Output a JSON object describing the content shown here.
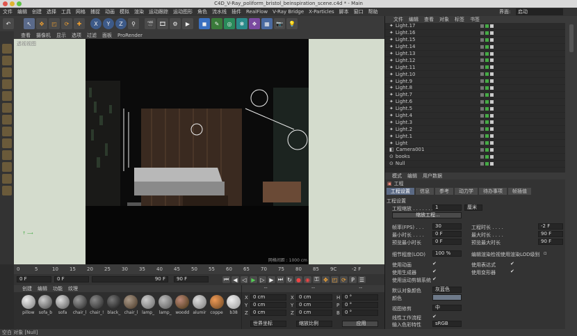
{
  "window": {
    "title": "C4D_V-Ray_poliform_bristol_beinspiration_scene.c4d * - Main"
  },
  "menu": [
    "文件",
    "编辑",
    "创建",
    "选择",
    "工具",
    "网格",
    "捕捉",
    "动画",
    "模拟",
    "渲染",
    "运动跟踪",
    "运动图形",
    "角色",
    "流水线",
    "插件",
    "RealFlow",
    "V-Ray Bridge",
    "X-Particles",
    "脚本",
    "窗口",
    "帮助"
  ],
  "layout": {
    "label": "界面:",
    "value": "启动"
  },
  "viewport": {
    "menu": [
      "查看",
      "摄像机",
      "显示",
      "选项",
      "过滤",
      "面板",
      "ProRender"
    ],
    "label": "透视视图",
    "grid_text": "网格间距 : 1000 cm"
  },
  "timeline": {
    "ticks": [
      "0",
      "5",
      "10",
      "15",
      "20",
      "25",
      "30",
      "35",
      "40",
      "45",
      "50",
      "55",
      "60",
      "65",
      "70",
      "75",
      "80",
      "85",
      "9C"
    ],
    "end_frame": "-2 F"
  },
  "playbar": {
    "start": "0 F",
    "current": "0 F",
    "end_a": "90 F",
    "end_b": "90 F"
  },
  "materials": {
    "menu": [
      "创建",
      "编辑",
      "功能",
      "纹理"
    ],
    "items": [
      "pillow",
      "sofa_b",
      "sofa",
      "chair_l",
      "chair_!",
      "black_",
      "chair_l",
      "lamp_",
      "lamp_",
      "woodd",
      "alumir",
      "coppe",
      "b38"
    ]
  },
  "coords": {
    "header": [
      "--",
      "--",
      "--"
    ],
    "rows": [
      {
        "axis": "X",
        "v1": "0 cm",
        "axis2": "X",
        "v2": "0 cm",
        "axis3": "H",
        "v3": "0 °"
      },
      {
        "axis": "Y",
        "v1": "0 cm",
        "axis2": "Y",
        "v2": "0 cm",
        "axis3": "P",
        "v3": "0 °"
      },
      {
        "axis": "Z",
        "v1": "0 cm",
        "axis2": "Z",
        "v2": "0 cm",
        "axis3": "B",
        "v3": "0 °"
      }
    ],
    "world": "世界坐标",
    "scale": "缩放比例",
    "apply": "应用"
  },
  "objects": {
    "tabs": [
      "文件",
      "编辑",
      "查看",
      "对象",
      "标签",
      "书签"
    ],
    "items": [
      "Light.17",
      "Light.16",
      "Light.15",
      "Light.14",
      "Light.13",
      "Light.12",
      "Light.11",
      "Light.10",
      "Light.9",
      "Light.8",
      "Light.7",
      "Light.6",
      "Light.5",
      "Light.4",
      "Light.3",
      "Light.2",
      "Light.1",
      "Light",
      "Camera001",
      "books",
      "Null"
    ]
  },
  "attributes": {
    "menu": [
      "模式",
      "编辑",
      "用户数据"
    ],
    "title": "工程",
    "tabs": [
      "工程设置",
      "信息",
      "参考",
      "动力学",
      "待办事项",
      "帧插值"
    ],
    "section": "工程设置",
    "scale_label": "工程缩放 . . . . . . .",
    "scale_value": "1",
    "scale_unit": "厘米",
    "scale_button": "缩放工程...",
    "left": [
      {
        "label": "帧率(FPS) . . .",
        "value": "30"
      },
      {
        "label": "最小时长 . . . .",
        "value": "0 F"
      },
      {
        "label": "预览最小时长",
        "value": "0 F"
      }
    ],
    "right": [
      {
        "label": "工程时长 . . . .",
        "value": "-2 F"
      },
      {
        "label": "最大时长 . . . .",
        "value": "90 F"
      },
      {
        "label": "预览最大时长",
        "value": "90 F"
      }
    ],
    "lod_label": "细节程度(LOD)",
    "lod_value": "100 %",
    "lod_check": "编辑渲染检视使用渲染LOD级别",
    "checks_left": [
      "使用动画",
      "使用生成器",
      "使用运动剪辑系统"
    ],
    "checks_right": [
      "使用表达式",
      "使用变形器"
    ],
    "default_color_label": "默认对象颜色",
    "default_color_value": "灰蓝色",
    "color_label": "颜色",
    "view_clip_label": "视图修剪",
    "view_clip_value": "中",
    "linear_label": "线性工作流程",
    "input_color_label": "输入色彩特性",
    "input_color_value": "sRGB"
  },
  "status": "空白 对象 [Null]"
}
